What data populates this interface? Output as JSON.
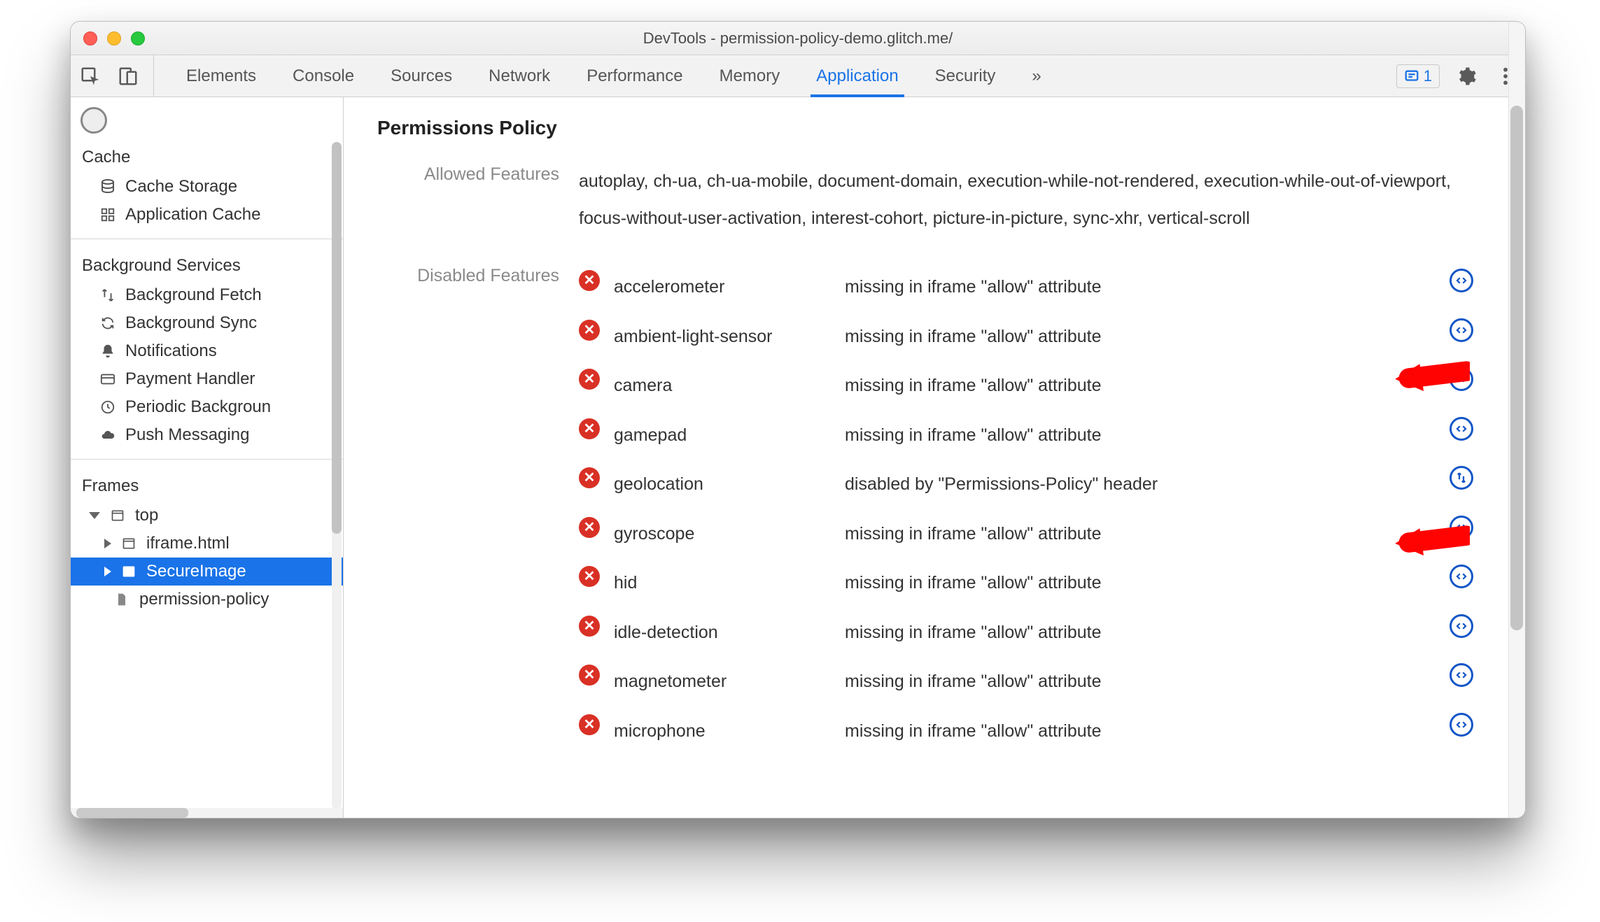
{
  "window": {
    "title": "DevTools - permission-policy-demo.glitch.me/"
  },
  "tabs": {
    "items": [
      "Elements",
      "Console",
      "Sources",
      "Network",
      "Performance",
      "Memory",
      "Application",
      "Security"
    ],
    "active": "Application",
    "overflow": "»"
  },
  "issues": {
    "count": "1"
  },
  "sidebar": {
    "cache_section": "Cache",
    "cache_items": [
      "Cache Storage",
      "Application Cache"
    ],
    "bg_section": "Background Services",
    "bg_items": [
      "Background Fetch",
      "Background Sync",
      "Notifications",
      "Payment Handler",
      "Periodic Backgroun",
      "Push Messaging"
    ],
    "frames_section": "Frames",
    "frames": {
      "top": "top",
      "children": [
        "iframe.html",
        "SecureImage",
        "permission-policy"
      ],
      "selected": "SecureImage"
    }
  },
  "main": {
    "heading": "Permissions Policy",
    "allowed_label": "Allowed Features",
    "allowed_text": "autoplay, ch-ua, ch-ua-mobile, document-domain, execution-while-not-rendered, execution-while-out-of-viewport, focus-without-user-activation, interest-cohort, picture-in-picture, sync-xhr, vertical-scroll",
    "disabled_label": "Disabled Features",
    "disabled": [
      {
        "name": "accelerometer",
        "reason": "missing in iframe \"allow\" attribute",
        "icon": "code"
      },
      {
        "name": "ambient-light-sensor",
        "reason": "missing in iframe \"allow\" attribute",
        "icon": "code"
      },
      {
        "name": "camera",
        "reason": "missing in iframe \"allow\" attribute",
        "icon": "code"
      },
      {
        "name": "gamepad",
        "reason": "missing in iframe \"allow\" attribute",
        "icon": "code"
      },
      {
        "name": "geolocation",
        "reason": "disabled by \"Permissions-Policy\" header",
        "icon": "net"
      },
      {
        "name": "gyroscope",
        "reason": "missing in iframe \"allow\" attribute",
        "icon": "code"
      },
      {
        "name": "hid",
        "reason": "missing in iframe \"allow\" attribute",
        "icon": "code"
      },
      {
        "name": "idle-detection",
        "reason": "missing in iframe \"allow\" attribute",
        "icon": "code"
      },
      {
        "name": "magnetometer",
        "reason": "missing in iframe \"allow\" attribute",
        "icon": "code"
      },
      {
        "name": "microphone",
        "reason": "missing in iframe \"allow\" attribute",
        "icon": "code"
      }
    ]
  }
}
